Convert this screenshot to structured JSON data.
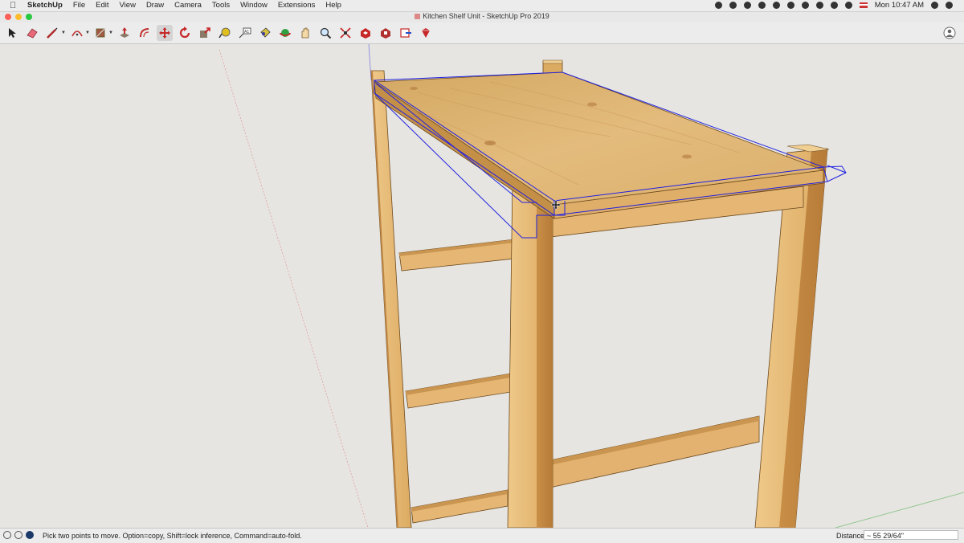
{
  "menubar": {
    "app": "SketchUp",
    "items": [
      "File",
      "Edit",
      "View",
      "Draw",
      "Camera",
      "Tools",
      "Window",
      "Extensions",
      "Help"
    ],
    "clock": "Mon 10:47 AM"
  },
  "window": {
    "title": "Kitchen Shelf Unit - SketchUp Pro 2019"
  },
  "toolbar": {
    "tools": [
      "select-icon",
      "eraser-icon",
      "line-icon",
      "arc-icon",
      "shape-icon",
      "push-pull-icon",
      "offset-icon",
      "move-icon",
      "rotate-icon",
      "scale-icon",
      "tape-measure-icon",
      "text-icon",
      "paint-bucket-icon",
      "orbit-icon",
      "pan-icon",
      "zoom-icon",
      "zoom-extents-icon",
      "warehouse-icon",
      "extension-warehouse-icon",
      "send-to-layout-icon",
      "ruby-icon"
    ],
    "active_tool": "move-icon"
  },
  "status": {
    "message": "Pick two points to move.  Option=copy, Shift=lock inference, Command=auto-fold.",
    "measurement_label": "Distance",
    "measurement_value": "~ 55 29/64\""
  },
  "colors": {
    "wood_light": "#e3b878",
    "wood_mid": "#d3a25e",
    "wood_dark": "#a8763a",
    "selection": "#2020e0",
    "background": "#e6e5e1"
  }
}
